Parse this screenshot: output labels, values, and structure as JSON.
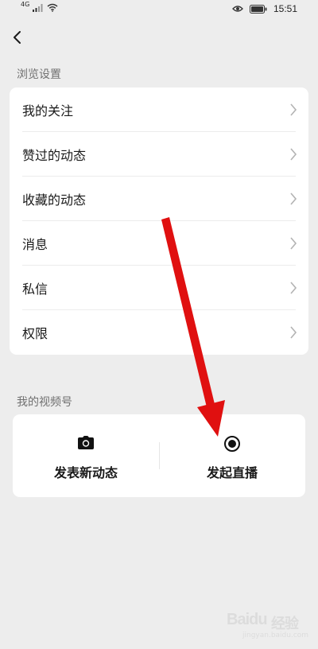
{
  "status_bar": {
    "network_type": "4G",
    "time": "15:51",
    "icons": [
      "signal-icon",
      "wifi-icon",
      "eye-icon",
      "battery-icon"
    ]
  },
  "nav": {
    "back_icon": "back-arrow-icon"
  },
  "browse_settings": {
    "title": "浏览设置",
    "items": [
      {
        "label": "我的关注"
      },
      {
        "label": "赞过的动态"
      },
      {
        "label": "收藏的动态"
      },
      {
        "label": "消息"
      },
      {
        "label": "私信"
      },
      {
        "label": "权限"
      }
    ]
  },
  "channels": {
    "title": "我的视频号",
    "actions": [
      {
        "label": "发表新动态",
        "icon": "camera-icon"
      },
      {
        "label": "发起直播",
        "icon": "live-record-icon"
      }
    ]
  },
  "annotation": {
    "color": "#e01010"
  },
  "watermark": {
    "brand": "Baidu",
    "sub": "jingyan.baidu.com",
    "text": "经验"
  }
}
